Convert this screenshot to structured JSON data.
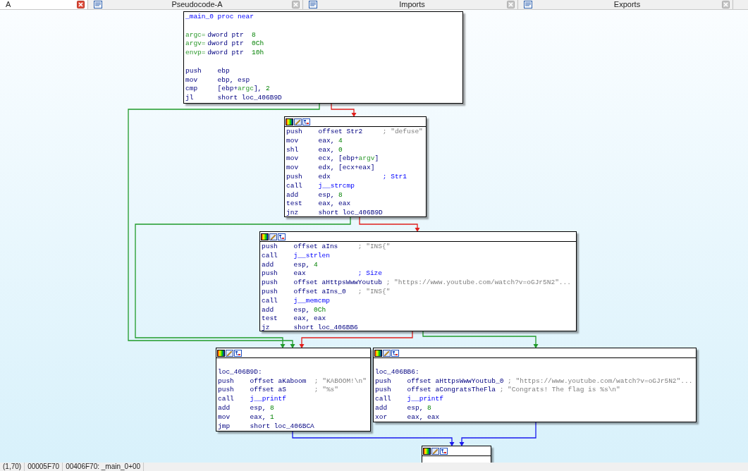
{
  "tabs": [
    {
      "label": "A",
      "selected": true,
      "icon": false
    },
    {
      "label": "Pseudocode-A",
      "selected": false,
      "icon": true
    },
    {
      "label": "Imports",
      "selected": false,
      "icon": true
    },
    {
      "label": "Exports",
      "selected": false,
      "icon": true
    }
  ],
  "graph": {
    "nodes": [
      {
        "header": false,
        "lines": [
          {
            "kind": "title",
            "text": "_main_0 proc near"
          },
          {
            "kind": "blank"
          },
          {
            "kind": "var",
            "name": "argc=",
            "text": "dword ptr",
            "value": "8"
          },
          {
            "kind": "var",
            "name": "argv=",
            "text": "dword ptr",
            "value": "0Ch"
          },
          {
            "kind": "var",
            "name": "envp=",
            "text": "dword ptr",
            "value": "10h"
          },
          {
            "kind": "blank"
          },
          {
            "kind": "instr",
            "op": "push",
            "args": [
              {
                "text": "ebp",
                "kind": "code"
              }
            ]
          },
          {
            "kind": "instr",
            "op": "mov",
            "args": [
              {
                "text": "ebp, esp",
                "kind": "code"
              }
            ]
          },
          {
            "kind": "instr",
            "op": "cmp",
            "args": [
              {
                "text": "[ebp+",
                "kind": "code"
              },
              {
                "text": "argc",
                "kind": "var"
              },
              {
                "text": "], ",
                "kind": "code"
              },
              {
                "text": "2",
                "kind": "num"
              }
            ]
          },
          {
            "kind": "instr",
            "op": "jl",
            "args": [
              {
                "text": "short loc_406B9D",
                "kind": "code"
              }
            ]
          }
        ]
      },
      {
        "header": true,
        "lines": [
          {
            "kind": "instr",
            "op": "push",
            "args": [
              {
                "text": "offset Str2",
                "kind": "code"
              }
            ],
            "comment": {
              "text": "; \"defuse\"",
              "kind": "string"
            }
          },
          {
            "kind": "instr",
            "op": "mov",
            "args": [
              {
                "text": "eax, ",
                "kind": "code"
              },
              {
                "text": "4",
                "kind": "num"
              }
            ]
          },
          {
            "kind": "instr",
            "op": "shl",
            "args": [
              {
                "text": "eax, ",
                "kind": "code"
              },
              {
                "text": "0",
                "kind": "num"
              }
            ]
          },
          {
            "kind": "instr",
            "op": "mov",
            "args": [
              {
                "text": "ecx, [ebp+",
                "kind": "code"
              },
              {
                "text": "argv",
                "kind": "var"
              },
              {
                "text": "]",
                "kind": "code"
              }
            ]
          },
          {
            "kind": "instr",
            "op": "mov",
            "args": [
              {
                "text": "edx, [ecx+eax]",
                "kind": "code"
              }
            ]
          },
          {
            "kind": "instr",
            "op": "push",
            "args": [
              {
                "text": "edx",
                "kind": "code"
              }
            ],
            "comment": {
              "text": "; Str1",
              "kind": "name"
            }
          },
          {
            "kind": "instr",
            "op": "call",
            "args": [
              {
                "text": "j__strcmp",
                "kind": "func"
              }
            ]
          },
          {
            "kind": "instr",
            "op": "add",
            "args": [
              {
                "text": "esp, ",
                "kind": "code"
              },
              {
                "text": "8",
                "kind": "num"
              }
            ]
          },
          {
            "kind": "instr",
            "op": "test",
            "args": [
              {
                "text": "eax, eax",
                "kind": "code"
              }
            ]
          },
          {
            "kind": "instr",
            "op": "jnz",
            "args": [
              {
                "text": "short loc_406B9D",
                "kind": "code"
              }
            ]
          }
        ]
      },
      {
        "header": true,
        "lines": [
          {
            "kind": "instr",
            "op": "push",
            "args": [
              {
                "text": "offset aIns",
                "kind": "code"
              }
            ],
            "comment": {
              "text": "; \"INS{\"",
              "kind": "string"
            }
          },
          {
            "kind": "instr",
            "op": "call",
            "args": [
              {
                "text": "j__strlen",
                "kind": "func"
              }
            ]
          },
          {
            "kind": "instr",
            "op": "add",
            "args": [
              {
                "text": "esp, ",
                "kind": "code"
              },
              {
                "text": "4",
                "kind": "num"
              }
            ]
          },
          {
            "kind": "instr",
            "op": "push",
            "args": [
              {
                "text": "eax",
                "kind": "code"
              }
            ],
            "comment": {
              "text": "; Size",
              "kind": "name"
            }
          },
          {
            "kind": "instr",
            "op": "push",
            "args": [
              {
                "text": "offset aHttpsWwwYoutub",
                "kind": "code"
              }
            ],
            "comment": {
              "text": "; \"https://www.youtube.com/watch?v=oGJr5N2\"...",
              "kind": "string"
            }
          },
          {
            "kind": "instr",
            "op": "push",
            "args": [
              {
                "text": "offset aIns_0",
                "kind": "code"
              }
            ],
            "comment": {
              "text": "; \"INS{\"",
              "kind": "string"
            }
          },
          {
            "kind": "instr",
            "op": "call",
            "args": [
              {
                "text": "j__memcmp",
                "kind": "func"
              }
            ]
          },
          {
            "kind": "instr",
            "op": "add",
            "args": [
              {
                "text": "esp, ",
                "kind": "code"
              },
              {
                "text": "0Ch",
                "kind": "num"
              }
            ]
          },
          {
            "kind": "instr",
            "op": "test",
            "args": [
              {
                "text": "eax, eax",
                "kind": "code"
              }
            ]
          },
          {
            "kind": "instr",
            "op": "jz",
            "args": [
              {
                "text": "short loc_406BB6",
                "kind": "code"
              }
            ]
          }
        ]
      },
      {
        "header": true,
        "lines": [
          {
            "kind": "blank"
          },
          {
            "kind": "label",
            "text": "loc_406B9D:"
          },
          {
            "kind": "instr",
            "op": "push",
            "args": [
              {
                "text": "offset aKaboom",
                "kind": "code"
              }
            ],
            "comment": {
              "text": "; \"KABOOM!\\n\"",
              "kind": "string"
            }
          },
          {
            "kind": "instr",
            "op": "push",
            "args": [
              {
                "text": "offset aS",
                "kind": "code"
              }
            ],
            "comment": {
              "text": "; \"%s\"",
              "kind": "string"
            }
          },
          {
            "kind": "instr",
            "op": "call",
            "args": [
              {
                "text": "j__printf",
                "kind": "func"
              }
            ]
          },
          {
            "kind": "instr",
            "op": "add",
            "args": [
              {
                "text": "esp, ",
                "kind": "code"
              },
              {
                "text": "8",
                "kind": "num"
              }
            ]
          },
          {
            "kind": "instr",
            "op": "mov",
            "args": [
              {
                "text": "eax, ",
                "kind": "code"
              },
              {
                "text": "1",
                "kind": "num"
              }
            ]
          },
          {
            "kind": "instr",
            "op": "jmp",
            "args": [
              {
                "text": "short loc_406BCA",
                "kind": "code"
              }
            ]
          }
        ]
      },
      {
        "header": true,
        "lines": [
          {
            "kind": "blank"
          },
          {
            "kind": "label",
            "text": "loc_406BB6:"
          },
          {
            "kind": "instr",
            "op": "push",
            "args": [
              {
                "text": "offset aHttpsWwwYoutub_0",
                "kind": "code"
              }
            ],
            "comment": {
              "text": "; \"https://www.youtube.com/watch?v=oGJr5N2\"...",
              "kind": "string"
            }
          },
          {
            "kind": "instr",
            "op": "push",
            "args": [
              {
                "text": "offset aCongratsTheFla",
                "kind": "code"
              }
            ],
            "comment": {
              "text": "; \"Congrats! The flag is %s\\n\"",
              "kind": "string"
            }
          },
          {
            "kind": "instr",
            "op": "call",
            "args": [
              {
                "text": "j__printf",
                "kind": "func"
              }
            ]
          },
          {
            "kind": "instr",
            "op": "add",
            "args": [
              {
                "text": "esp, ",
                "kind": "code"
              },
              {
                "text": "8",
                "kind": "num"
              }
            ]
          },
          {
            "kind": "instr",
            "op": "xor",
            "args": [
              {
                "text": "eax, eax",
                "kind": "code"
              }
            ]
          }
        ]
      },
      {
        "header": true
      }
    ],
    "edges": [
      {
        "kind": "false"
      },
      {
        "kind": "true"
      },
      {
        "kind": "false"
      },
      {
        "kind": "true"
      },
      {
        "kind": "false"
      },
      {
        "kind": "true"
      },
      {
        "kind": "jump"
      },
      {
        "kind": "jump"
      }
    ]
  },
  "status_bar": [
    "(1,70)",
    "00005F70",
    "00406F70: _main_0+00"
  ]
}
